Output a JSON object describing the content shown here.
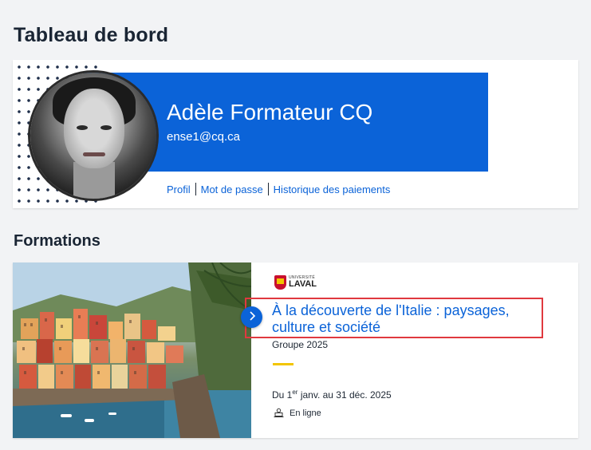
{
  "page": {
    "title": "Tableau de bord"
  },
  "profile": {
    "name": "Adèle Formateur CQ",
    "email": "ense1@cq.ca",
    "links": {
      "profile": "Profil",
      "password": "Mot de passe",
      "payments": "Historique des paiements"
    }
  },
  "formations": {
    "section_title": "Formations",
    "course": {
      "university_small": "UNIVERSITÉ",
      "university_big": "LAVAL",
      "title": "À la découverte de l'Italie : paysages, culture et société",
      "group": "Groupe 2025",
      "dates_prefix": "Du 1",
      "dates_sup": "er",
      "dates_suffix": " janv. au 31 déc. 2025",
      "mode": "En ligne"
    }
  },
  "colors": {
    "primary": "#0b63d8",
    "accent": "#f2c500",
    "highlight": "#e0393f"
  },
  "icons": {
    "next": "chevron-right-icon",
    "mode": "laptop-user-icon"
  }
}
